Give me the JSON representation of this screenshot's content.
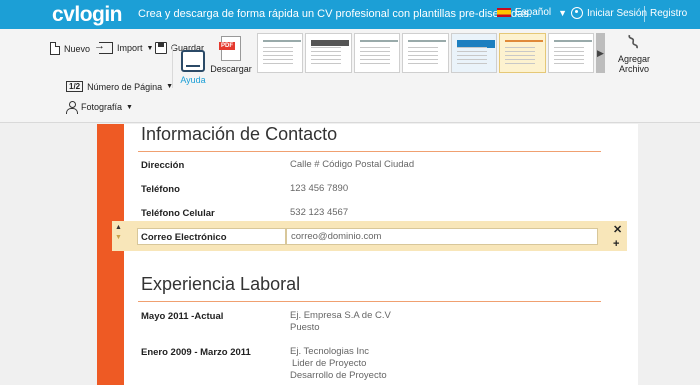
{
  "header": {
    "logo": "cvlogin",
    "tagline": "Crea y descarga de forma rápida un CV profesional con plantillas pre-diseñadas.",
    "language": "Español",
    "login": "Iniciar Sesión",
    "register": "Registro"
  },
  "toolbar": {
    "new": "Nuevo",
    "import": "Import",
    "save": "Guardar",
    "page_number": "Número de Página",
    "page_icon": "1/2",
    "photo": "Fotografía",
    "help": "Ayuda",
    "download": "Descargar",
    "pdf_badge": "PDF",
    "add_file": "Agregar Archivo"
  },
  "contact": {
    "title": "Información de Contacto",
    "address_label": "Dirección",
    "address_value": "Calle # Código Postal Ciudad",
    "phone_label": "Teléfono",
    "phone_value": "123 456 7890",
    "cell_label": "Teléfono Celular",
    "cell_value": "532 123 4567",
    "email_label": "Correo Electrónico",
    "email_value": "correo@dominio.com"
  },
  "experience": {
    "title": "Experiencia Laboral",
    "jobs": [
      {
        "dates": "Mayo 2011 -Actual",
        "company": "Ej. Empresa S.A de C.V",
        "role": "Puesto"
      },
      {
        "dates": "Enero 2009 - Marzo 2011",
        "company": "Ej. Tecnologias Inc",
        "role": "Lider de Proyecto",
        "role2": "Desarrollo de Proyecto"
      }
    ]
  },
  "icons": {
    "close": "✕",
    "add": "+",
    "up": "▲",
    "down": "▼"
  },
  "colors": {
    "brand_blue": "#1c9fd6",
    "accent_orange": "#ee5a24",
    "edit_highlight": "#f8e6b9"
  }
}
